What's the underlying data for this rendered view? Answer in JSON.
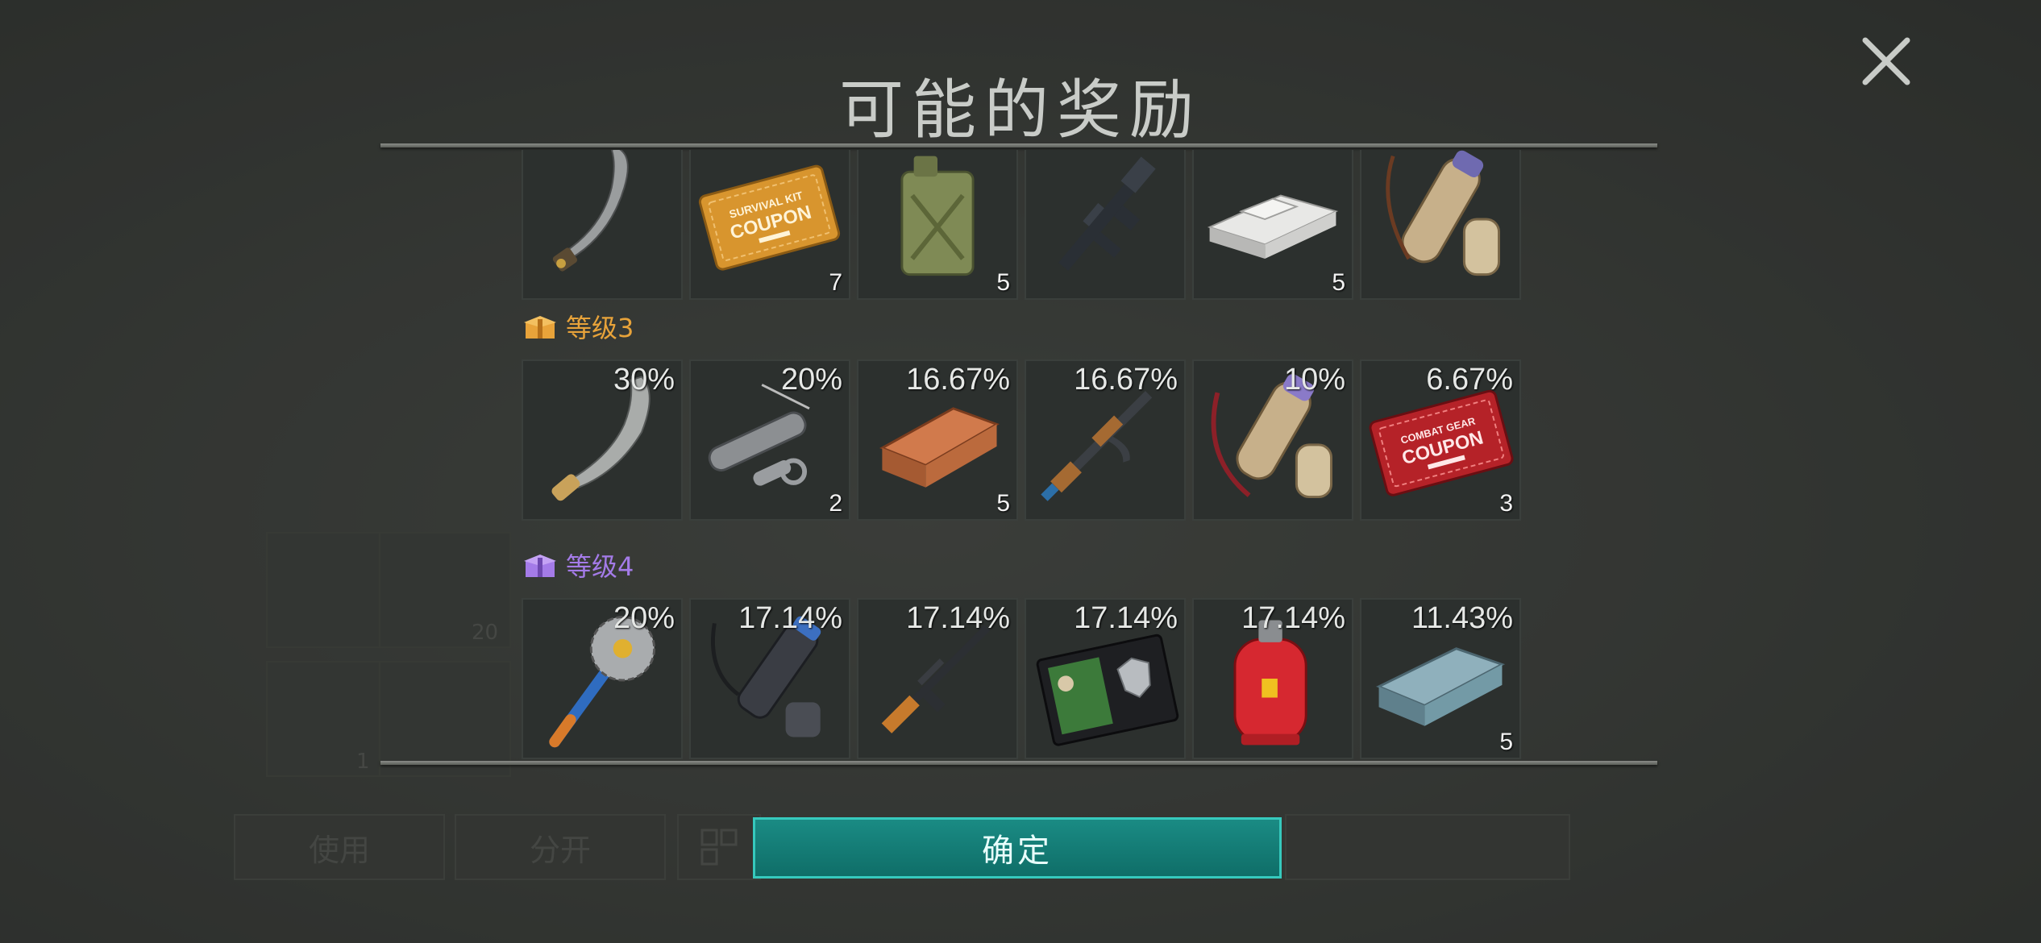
{
  "modal": {
    "title": "可能的奖励",
    "confirm_label": "确定"
  },
  "tier_top": {
    "items": [
      {
        "name": "machete",
        "count": ""
      },
      {
        "name": "survival-kit-coupon",
        "count": "7",
        "coupon_line1": "SURVIVAL KIT",
        "coupon_line2": "COUPON"
      },
      {
        "name": "jerrycan",
        "count": "5"
      },
      {
        "name": "assault-rifle-m16",
        "count": ""
      },
      {
        "name": "aluminum-ingots",
        "count": "5"
      },
      {
        "name": "quiver",
        "count": ""
      }
    ]
  },
  "tier3": {
    "label": "等级3",
    "color": "#e8a33a",
    "items": [
      {
        "name": "broad-machete",
        "chance": "30%",
        "count": ""
      },
      {
        "name": "suppressor-parts",
        "chance": "20%",
        "count": "2"
      },
      {
        "name": "copper-ingot",
        "chance": "16.67%",
        "count": "5"
      },
      {
        "name": "ak-rifle",
        "chance": "16.67%",
        "count": ""
      },
      {
        "name": "quiver-red",
        "chance": "10%",
        "count": ""
      },
      {
        "name": "combat-gear-coupon",
        "chance": "6.67%",
        "count": "3",
        "coupon_line1": "COMBAT GEAR",
        "coupon_line2": "COUPON"
      }
    ]
  },
  "tier4": {
    "label": "等级4",
    "color": "#a47be8",
    "items": [
      {
        "name": "saw-mace",
        "chance": "20%",
        "count": ""
      },
      {
        "name": "tactical-flashlight",
        "chance": "17.14%",
        "count": ""
      },
      {
        "name": "svd-rifle",
        "chance": "17.14%",
        "count": ""
      },
      {
        "name": "police-badge-wallet",
        "chance": "17.14%",
        "count": ""
      },
      {
        "name": "gas-cylinder",
        "chance": "17.14%",
        "count": ""
      },
      {
        "name": "steel-ingot",
        "chance": "11.43%",
        "count": "5"
      }
    ]
  },
  "background": {
    "use_label": "使用",
    "split_label": "分开",
    "slot_counts": [
      "20",
      "1"
    ]
  }
}
